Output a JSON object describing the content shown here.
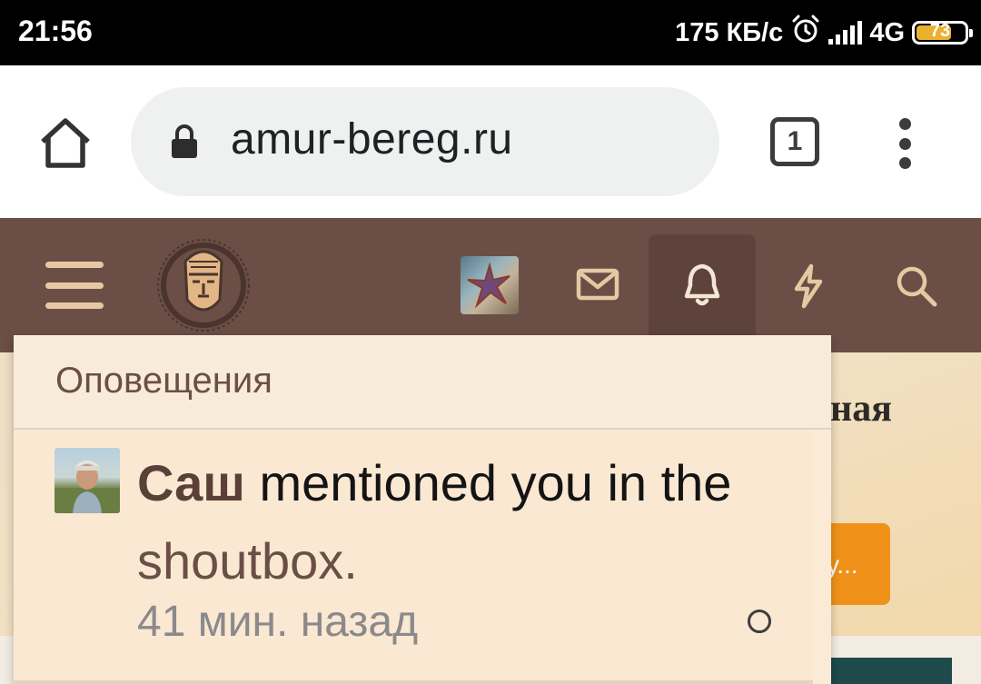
{
  "status_bar": {
    "time": "21:56",
    "speed": "175 КБ/с",
    "network": "4G",
    "battery": "73",
    "battery_level": 0.73,
    "alarm_icon": "alarm-clock-icon",
    "signal_icon": "signal-bars-icon"
  },
  "browser": {
    "url": "amur-bereg.ru",
    "tab_count": "1",
    "home_icon": "home-icon",
    "lock_icon": "lock-icon",
    "menu_icon": "more-vertical-icon"
  },
  "site_header": {
    "background": "#6b4f46",
    "icons": [
      "menu-icon",
      "site-logo",
      "user-avatar",
      "mail-icon",
      "bell-icon",
      "lightning-icon",
      "search-icon"
    ],
    "accent": "#e6c9a2"
  },
  "notifications": {
    "title": "Оповещения",
    "items": [
      {
        "user": "Саш",
        "action": "mentioned you in the",
        "content": "shoutbox.",
        "time": "41 мин. назад"
      }
    ]
  },
  "background_page": {
    "title_fragment": "ная",
    "button_fragment": "у..."
  }
}
